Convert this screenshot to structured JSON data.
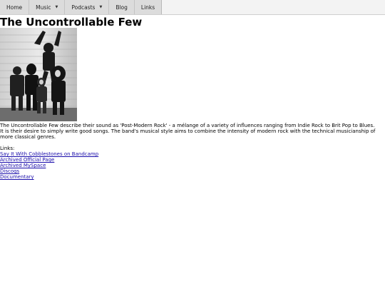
{
  "nav": {
    "home": "Home",
    "music": "Music",
    "podcasts": "Podcasts",
    "blog": "Blog",
    "links": "Links",
    "dropdown_caret": "▼"
  },
  "page": {
    "title": "The Uncontrollable Few",
    "description": "The Uncontrollable Few describe their sound as 'Post-Modern Rock' - a mélange of a variety of influences ranging from Indie Rock to Brit Pop to Blues. It is their desire to simply write good songs. The band's musical style aims to combine the intensity of modern rock with the technical musicianship of more classical genres.",
    "links_label": "Links:",
    "links": [
      "Say It With Cobblestones on Bandcamp",
      "Archived Official Page",
      "Archived MySpace",
      "Discogs",
      "Documentary"
    ]
  }
}
